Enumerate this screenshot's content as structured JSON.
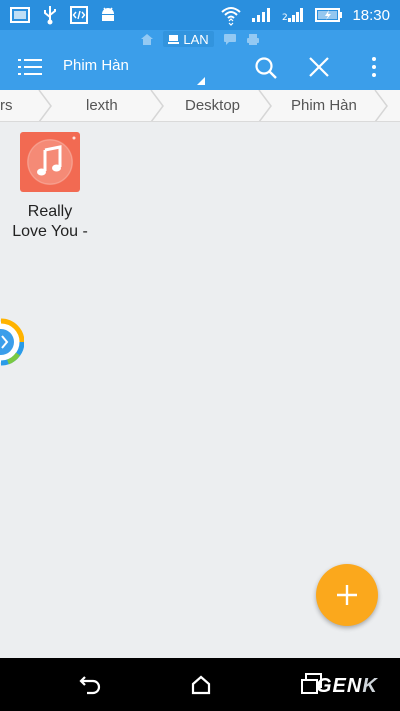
{
  "status_bar": {
    "time": "18:30",
    "left_icons": [
      "gallery-icon",
      "usb-icon",
      "developer-icon",
      "android-icon"
    ],
    "right_icons": [
      "wifi-icon",
      "signal-icon",
      "signal-2-icon",
      "battery-charging-icon"
    ]
  },
  "window_tabs": {
    "home_icon": "home-icon",
    "active_label": "LAN",
    "active_icon": "computer-icon",
    "other_icons": [
      "chat-icon",
      "printer-icon"
    ]
  },
  "toolbar": {
    "title": "Phim Hàn",
    "menu_icon": "menu-icon",
    "search_icon": "search-icon",
    "close_icon": "close-icon",
    "more_icon": "more-vertical-icon"
  },
  "breadcrumb": [
    "rs",
    "lexth",
    "Desktop",
    "Phim Hàn"
  ],
  "files": [
    {
      "name_line1": "Really",
      "name_line2": "Love You -",
      "icon": "music-file-icon"
    }
  ],
  "fab": {
    "icon": "plus-icon"
  },
  "nav_bar": {
    "back_icon": "back-icon",
    "home_icon": "home-icon",
    "recent_icon": "recent-apps-icon"
  },
  "watermark": {
    "text_main": "GEN",
    "text_k": "K"
  },
  "colors": {
    "status_bar": "#2a8fde",
    "toolbar": "#3b9eea",
    "fab": "#fba81c",
    "music_icon": "#f26a52"
  }
}
